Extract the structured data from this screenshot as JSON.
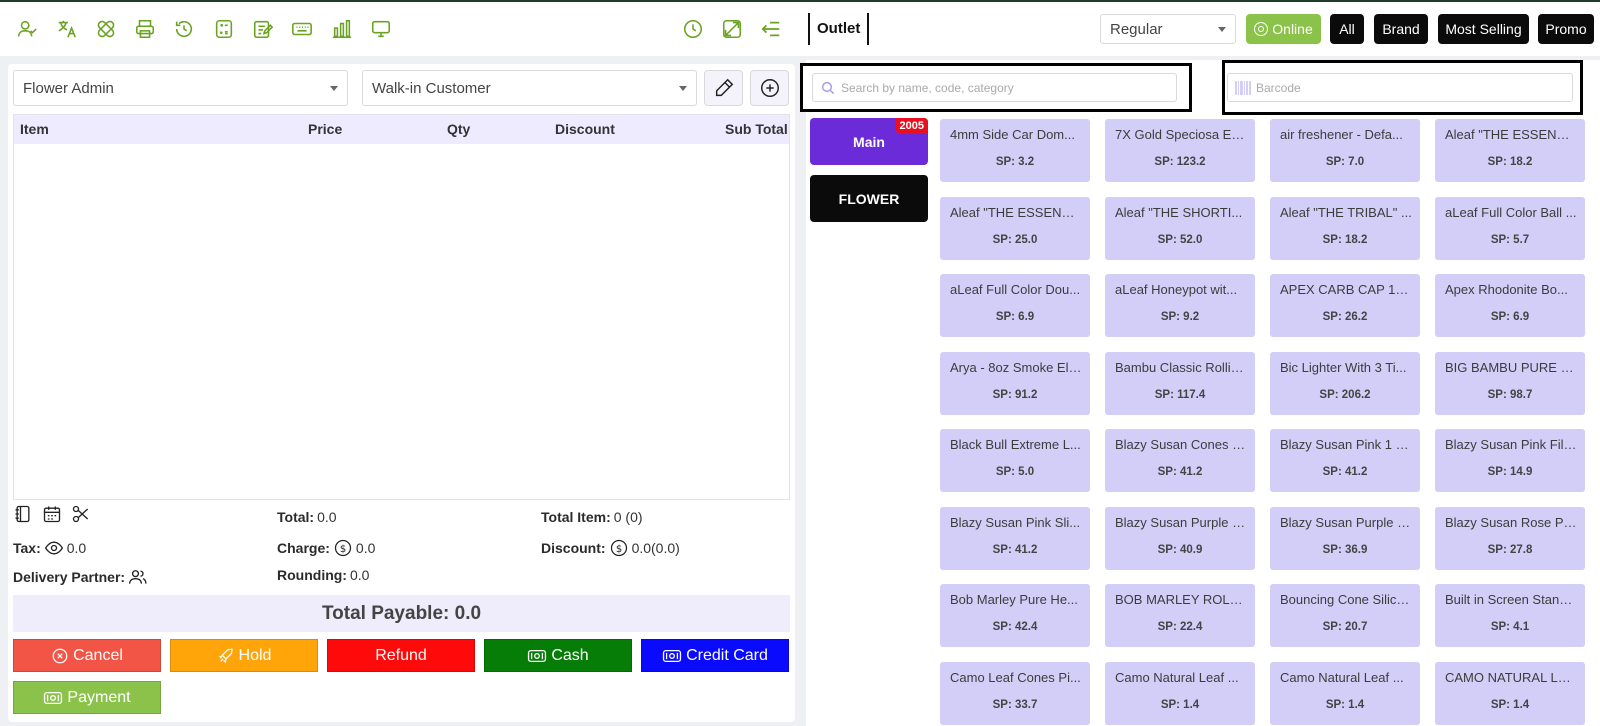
{
  "topbar": {
    "outlet": "Outlet",
    "price_type": "Regular",
    "online": "Online",
    "filters": [
      "All",
      "Brand",
      "Most Selling",
      "Promo"
    ],
    "icons": [
      "user-icon",
      "translate-icon",
      "bandage-icon",
      "printer-icon",
      "history-icon",
      "calculator-icon",
      "edit-note-icon",
      "keyboard-icon",
      "bar-chart-icon",
      "monitor-icon",
      "clock-icon",
      "fullscreen-icon",
      "menu-collapse-icon"
    ]
  },
  "order": {
    "waiter": "Flower Admin",
    "customer": "Walk-in Customer",
    "columns": [
      "Item",
      "Price",
      "Qty",
      "Discount",
      "Sub Total"
    ]
  },
  "summary": {
    "total_label": "Total:",
    "total_value": "0.0",
    "total_item_label": "Total Item:",
    "total_item_value": "0 (0)",
    "tax_label": "Tax:",
    "tax_value": "0.0",
    "charge_label": "Charge:",
    "charge_value": "0.0",
    "discount_label": "Discount:",
    "discount_value": "0.0(0.0)",
    "delivery_label": "Delivery Partner:",
    "rounding_label": "Rounding:",
    "rounding_value": "0.0",
    "total_payable": "Total Payable: 0.0"
  },
  "actions": {
    "cancel": "Cancel",
    "hold": "Hold",
    "refund": "Refund",
    "cash": "Cash",
    "credit_card": "Credit Card",
    "payment": "Payment"
  },
  "colors": {
    "cancel": "#f25545",
    "hold": "#ffa50a",
    "refund": "#ff0a0a",
    "cash": "#067d06",
    "credit_card": "#0a0aff",
    "payment": "#8bc34a",
    "main_category": "#6c2bd9",
    "flower_category": "#0b0b0b",
    "product_card": "#d3cef8"
  },
  "search": {
    "placeholder": "Search by name, code, category",
    "barcode_placeholder": "Barcode"
  },
  "categories": [
    {
      "label": "Main",
      "badge": "2005"
    },
    {
      "label": "FLOWER"
    }
  ],
  "products": [
    {
      "name": "4mm Side Car Dom...",
      "price": "SP: 3.2"
    },
    {
      "name": "7X Gold Speciosa Ex...",
      "price": "SP: 123.2"
    },
    {
      "name": "air freshener - Defa...",
      "price": "SP: 7.0"
    },
    {
      "name": "Aleaf \"THE ESSENTI...",
      "price": "SP: 18.2"
    },
    {
      "name": "Aleaf \"THE ESSENTI...",
      "price": "SP: 25.0"
    },
    {
      "name": "Aleaf \"THE SHORTI...",
      "price": "SP: 52.0"
    },
    {
      "name": "Aleaf \"THE TRIBAL\" ...",
      "price": "SP: 18.2"
    },
    {
      "name": "aLeaf Full Color Ball ...",
      "price": "SP: 5.7"
    },
    {
      "name": "aLeaf Full Color Dou...",
      "price": "SP: 6.9"
    },
    {
      "name": "aLeaf Honeypot wit...",
      "price": "SP: 9.2"
    },
    {
      "name": "APEX CARB CAP 12...",
      "price": "SP: 26.2"
    },
    {
      "name": "Apex Rhodonite Bo...",
      "price": "SP: 6.9"
    },
    {
      "name": "Arya - 8oz Smoke Eli...",
      "price": "SP: 91.2"
    },
    {
      "name": "Bambu Classic Rollin...",
      "price": "SP: 117.4"
    },
    {
      "name": "Bic Lighter With 3 Ti...",
      "price": "SP: 206.2"
    },
    {
      "name": "BIG BAMBU PURE H...",
      "price": "SP: 98.7"
    },
    {
      "name": "Black Bull Extreme L...",
      "price": "SP: 5.0"
    },
    {
      "name": "Blazy Susan Cones a...",
      "price": "SP: 41.2"
    },
    {
      "name": "Blazy Susan Pink 1 ¼ ...",
      "price": "SP: 41.2"
    },
    {
      "name": "Blazy Susan Pink Filt...",
      "price": "SP: 14.9"
    },
    {
      "name": "Blazy Susan Pink Sli...",
      "price": "SP: 41.2"
    },
    {
      "name": "Blazy Susan Purple P...",
      "price": "SP: 40.9"
    },
    {
      "name": "Blazy Susan Purple S...",
      "price": "SP: 36.9"
    },
    {
      "name": "Blazy Susan Rose Pe...",
      "price": "SP: 27.8"
    },
    {
      "name": "Bob Marley Pure He...",
      "price": "SP: 42.4"
    },
    {
      "name": "BOB MARLEY ROLLI...",
      "price": "SP: 22.4"
    },
    {
      "name": "Bouncing Cone Silico...",
      "price": "SP: 20.7"
    },
    {
      "name": "Built in Screen Stand...",
      "price": "SP: 4.1"
    },
    {
      "name": "Camo Leaf Cones Pi...",
      "price": "SP: 33.7"
    },
    {
      "name": "Camo Natural Leaf ...",
      "price": "SP: 1.4"
    },
    {
      "name": "Camo Natural Leaf ...",
      "price": "SP: 1.4"
    },
    {
      "name": "CAMO NATURAL LE...",
      "price": "SP: 1.4"
    }
  ]
}
